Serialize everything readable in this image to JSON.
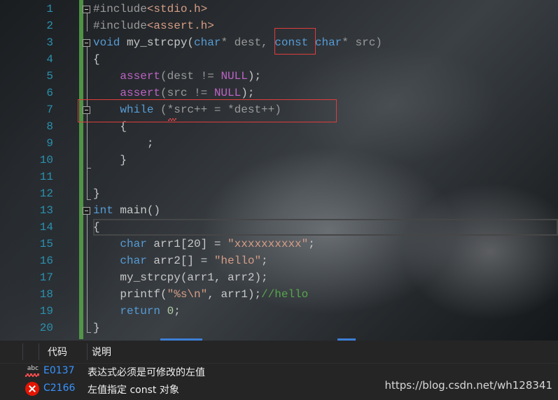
{
  "editor": {
    "line_numbers": [
      "1",
      "2",
      "3",
      "4",
      "5",
      "6",
      "7",
      "8",
      "9",
      "10",
      "11",
      "12",
      "13",
      "14",
      "15",
      "16",
      "17",
      "18",
      "19",
      "20"
    ],
    "lines": [
      "#include<stdio.h>",
      "#include<assert.h>",
      "void my_strcpy(char* dest, const char* src)",
      "{",
      "    assert(dest != NULL);",
      "    assert(src != NULL);",
      "    while (*src++ = *dest++)",
      "    {",
      "        ;",
      "    }",
      "",
      "}",
      "int main()",
      "{",
      "    char arr1[20] = \"xxxxxxxxxx\";",
      "    char arr2[] = \"hello\";",
      "    my_strcpy(arr1, arr2);",
      "    printf(\"%s\\n\", arr1);//hello",
      "    return 0;",
      "}"
    ],
    "tokens": {
      "l1_pp": "#include",
      "l1_inc": "<stdio.h>",
      "l2_pp": "#include",
      "l2_inc": "<assert.h>",
      "l3_void": "void",
      "l3_name": " my_strcpy(",
      "l3_char1": "char",
      "l3_dest": "* dest, ",
      "l3_const": "const",
      "l3_char2": " char",
      "l3_src": "* src)",
      "l4": "{",
      "l5_fn": "assert",
      "l5_args": "(dest != ",
      "l5_null": "NULL",
      "l5_end": ");",
      "l6_fn": "assert",
      "l6_args": "(src != ",
      "l6_null": "NULL",
      "l6_end": ");",
      "l7_while": "while",
      "l7_rest": " (*src++ = *dest++)",
      "l8": "{",
      "l9": ";",
      "l10": "}",
      "l12": "}",
      "l13_int": "int",
      "l13_rest": " main()",
      "l14": "{",
      "l15_char": "char",
      "l15_mid": " arr1[20] = ",
      "l15_str": "\"xxxxxxxxxx\"",
      "l15_end": ";",
      "l16_char": "char",
      "l16_mid": " arr2[] = ",
      "l16_str": "\"hello\"",
      "l16_end": ";",
      "l17": "my_strcpy(arr1, arr2);",
      "l18_fn": "printf(",
      "l18_str": "\"%s\\n\"",
      "l18_mid": ", arr1);",
      "l18_cmt": "//hello",
      "l19_ret": "return",
      "l19_num": " 0",
      "l19_end": ";",
      "l20": "}"
    }
  },
  "error_list": {
    "columns": {
      "code": "代码",
      "description": "说明"
    },
    "rows": [
      {
        "icon": "spell-squiggle-icon",
        "code": "E0137",
        "description": "表达式必须是可修改的左值"
      },
      {
        "icon": "error-x-icon",
        "code": "C2166",
        "description": "左值指定 const 对象"
      }
    ]
  },
  "watermark": "https://blog.csdn.net/wh128341",
  "colors": {
    "keyword": "#569cd6",
    "macro": "#bd63c5",
    "string": "#d69d85",
    "comment": "#57a64a",
    "line_number": "#2b91af",
    "highlight_box": "#e03c3c",
    "error_code": "#3794ff"
  }
}
